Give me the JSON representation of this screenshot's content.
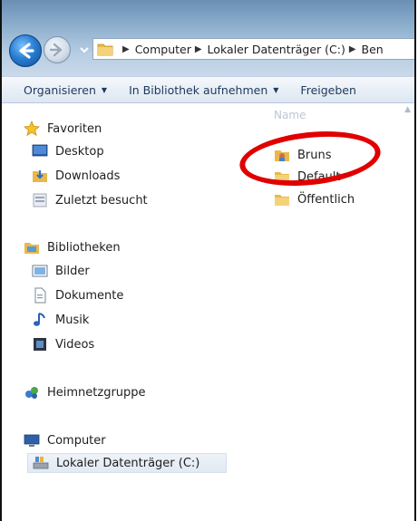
{
  "address": {
    "crumbs": [
      "Computer",
      "Lokaler Datenträger (C:)",
      "Ben"
    ]
  },
  "toolbar": {
    "organize_label": "Organisieren",
    "library_label": "In Bibliothek aufnehmen",
    "share_label": "Freigeben"
  },
  "nav": {
    "favorites": {
      "label": "Favoriten",
      "items": [
        {
          "label": "Desktop",
          "icon": "desktop-icon"
        },
        {
          "label": "Downloads",
          "icon": "downloads-folder-icon"
        },
        {
          "label": "Zuletzt besucht",
          "icon": "recent-places-icon"
        }
      ]
    },
    "libraries": {
      "label": "Bibliotheken",
      "items": [
        {
          "label": "Bilder",
          "icon": "pictures-library-icon"
        },
        {
          "label": "Dokumente",
          "icon": "documents-library-icon"
        },
        {
          "label": "Musik",
          "icon": "music-library-icon"
        },
        {
          "label": "Videos",
          "icon": "videos-library-icon"
        }
      ]
    },
    "homegroup": {
      "label": "Heimnetzgruppe"
    },
    "computer": {
      "label": "Computer",
      "items": [
        {
          "label": "Lokaler Datenträger (C:)",
          "icon": "local-disk-icon",
          "selected": true
        }
      ]
    }
  },
  "content": {
    "column_header": "Name",
    "files": [
      {
        "name": "Bruns",
        "icon": "user-folder-icon"
      },
      {
        "name": "Default",
        "icon": "folder-icon"
      },
      {
        "name": "Öffentlich",
        "icon": "folder-icon"
      }
    ]
  },
  "colors": {
    "annotation": "#e00000",
    "toolbar_text": "#1e395b"
  }
}
